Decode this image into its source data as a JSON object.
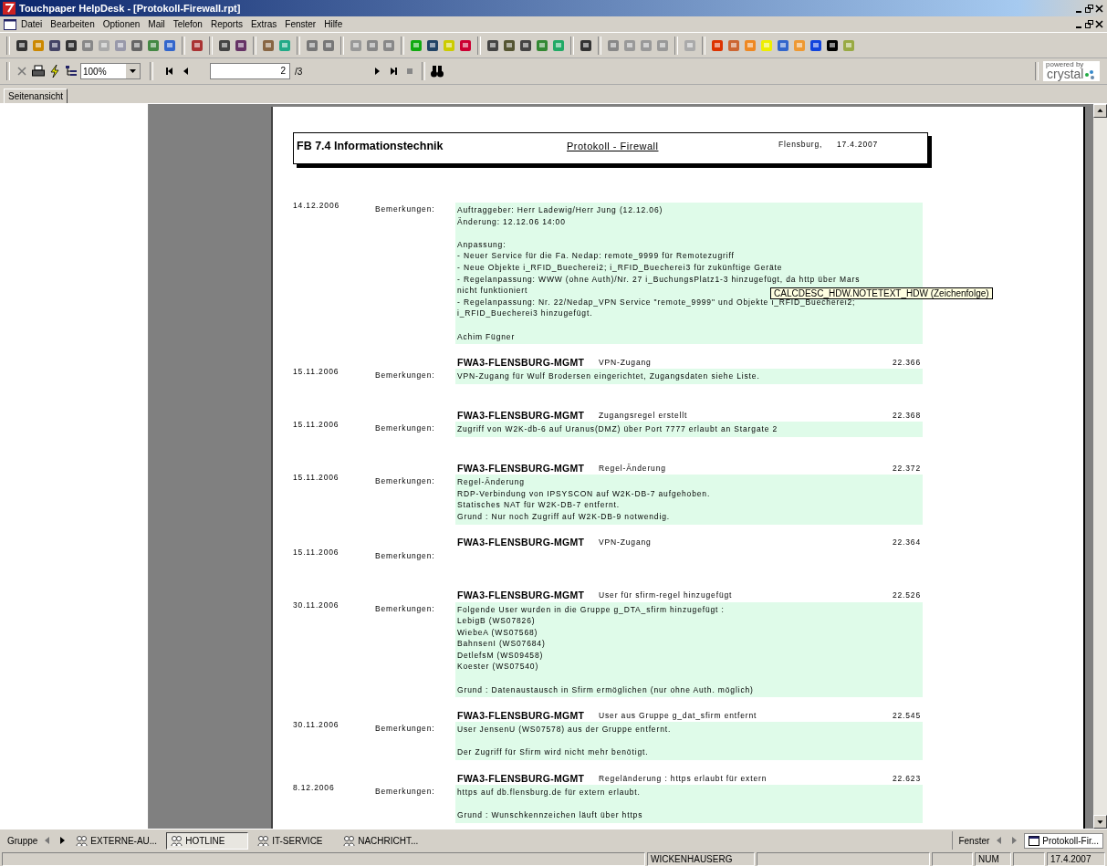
{
  "window": {
    "title": "Touchpaper HelpDesk - [Protokoll-Firewall.rpt]"
  },
  "menu": [
    "Datei",
    "Bearbeiten",
    "Optionen",
    "Mail",
    "Telefon",
    "Reports",
    "Extras",
    "Fenster",
    "Hilfe"
  ],
  "viewer_toolbar": {
    "zoom": "100%",
    "page": "2",
    "page_count": "/3"
  },
  "brand": {
    "small": "powered by",
    "name": "crystal"
  },
  "tabs": [
    {
      "label": "Seitenansicht",
      "selected": true
    }
  ],
  "report": {
    "department": "FB 7.4 Informationstechnik",
    "title": "Protokoll - Firewall",
    "place": "Flensburg,",
    "date": "17.4.2007",
    "entries": [
      {
        "date": "14.12.2006",
        "label": "Bemerkungen:",
        "paragraphs": [
          [
            "Auftraggeber: Herr Ladewig/Herr Jung (12.12.06)",
            "Änderung: 12.12.06 14:00"
          ],
          [
            "Anpassung:",
            "- Neuer Service für die Fa. Nedap: remote_9999 für Remotezugriff",
            "- Neue Objekte i_RFID_Buecherei2; i_RFID_Buecherei3 für zukünftige Geräte",
            "- Regelanpassung: WWW (ohne Auth)/Nr. 27 i_BuchungsPlatz1-3 hinzugefügt, da http über Mars",
            "nicht funktioniert",
            "- Regelanpassung: Nr. 22/Nedap_VPN Service \"remote_9999\" und Objekte i_RFID_Buecherei2;",
            "i_RFID_Buecherei3 hinzugefügt."
          ],
          [
            "Achim Fügner"
          ]
        ]
      },
      {
        "host": "FWA3-FLENSBURG-MGMT",
        "topic": "VPN-Zugang",
        "number": "22.366",
        "date": "15.11.2006",
        "label": "Bemerkungen:",
        "paragraphs": [
          [
            "VPN-Zugang für Wulf Brodersen eingerichtet, Zugangsdaten siehe Liste."
          ]
        ]
      },
      {
        "host": "FWA3-FLENSBURG-MGMT",
        "topic": "Zugangsregel erstellt",
        "number": "22.368",
        "date": "15.11.2006",
        "label": "Bemerkungen:",
        "paragraphs": [
          [
            "Zugriff von W2K-db-6 auf Uranus(DMZ) über Port 7777 erlaubt an Stargate 2"
          ]
        ]
      },
      {
        "host": "FWA3-FLENSBURG-MGMT",
        "topic": "Regel-Änderung",
        "number": "22.372",
        "date": "15.11.2006",
        "label": "Bemerkungen:",
        "paragraphs": [
          [
            "Regel-Änderung",
            "RDP-Verbindung von IPSYSCON auf W2K-DB-7 aufgehoben.",
            "Statisches NAT für W2K-DB-7 entfernt.",
            "Grund : Nur noch Zugriff auf W2K-DB-9 notwendig."
          ]
        ]
      },
      {
        "host": "FWA3-FLENSBURG-MGMT",
        "topic": "VPN-Zugang",
        "number": "22.364",
        "date": "15.11.2006",
        "label": "Bemerkungen:"
      },
      {
        "host": "FWA3-FLENSBURG-MGMT",
        "topic": "User für sfirm-regel hinzugefügt",
        "number": "22.526",
        "date": "30.11.2006",
        "label": "Bemerkungen:",
        "paragraphs": [
          [
            "Folgende User wurden in die Gruppe g_DTA_sfirm hinzugefügt :",
            "LebigB (WS07826)",
            "WiebeA (WS07568)",
            "BahnsenI (WS07684)",
            "DetlefsM (WS09458)",
            "Koester (WS07540)"
          ],
          [
            "Grund : Datenaustausch in Sfirm ermöglichen (nur ohne Auth. möglich)"
          ]
        ]
      },
      {
        "host": "FWA3-FLENSBURG-MGMT",
        "topic": "User aus Gruppe g_dat_sfirm entfernt",
        "number": "22.545",
        "date": "30.11.2006",
        "label": "Bemerkungen:",
        "paragraphs": [
          [
            "User JensenU (WS07578) aus der Gruppe entfernt."
          ],
          [
            "Der Zugriff für Sfirm wird nicht mehr benötigt."
          ]
        ]
      },
      {
        "host": "FWA3-FLENSBURG-MGMT",
        "topic": "Regeländerung : https erlaubt für extern",
        "number": "22.623",
        "date": "8.12.2006",
        "label": "Bemerkungen:",
        "paragraphs": [
          [
            "https auf db.flensburg.de für extern erlaubt."
          ],
          [
            "Grund : Wunschkennzeichen läuft über https"
          ]
        ]
      }
    ]
  },
  "tooltip": "CALCDESC_HDW.NOTETEXT_HDW (Zeichenfolge)",
  "group_bar": {
    "label": "Gruppe",
    "items": [
      {
        "label": "EXTERNE-AU...",
        "selected": false
      },
      {
        "label": "HOTLINE",
        "selected": true
      },
      {
        "label": "IT-SERVICE",
        "selected": false
      },
      {
        "label": "NACHRICHT...",
        "selected": false
      }
    ],
    "window_label": "Fenster",
    "window_item": "Protokoll-Fir..."
  },
  "status_bar": {
    "user": "WICKENHAUSERG",
    "keys": "NUM",
    "date": "17.4.2007"
  }
}
